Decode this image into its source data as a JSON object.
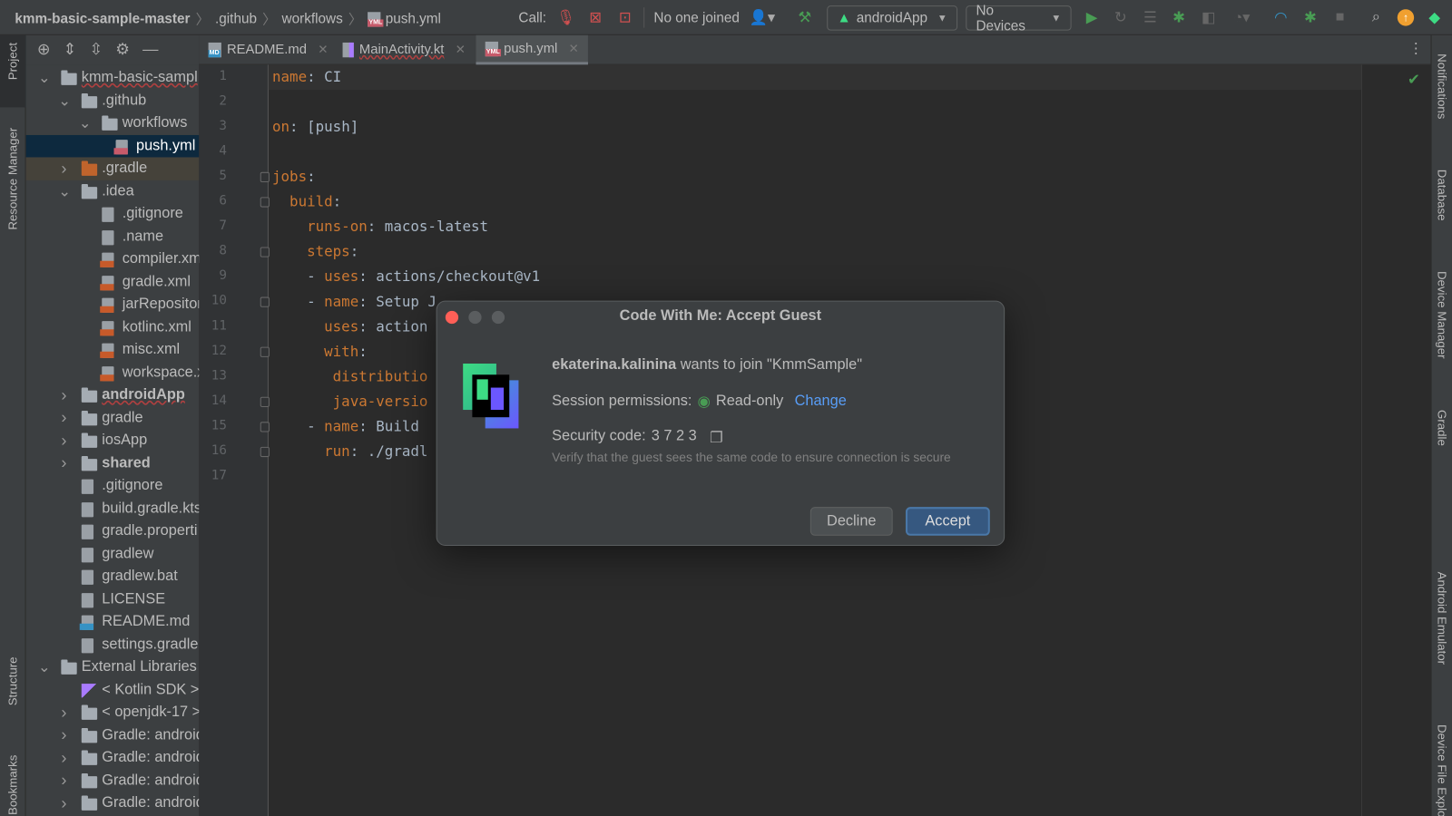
{
  "topbar": {
    "breadcrumb": [
      "kmm-basic-sample-master",
      ".github",
      "workflows",
      "push.yml"
    ],
    "call_label": "Call:",
    "participants": "No one joined",
    "run_config": "androidApp",
    "device": "No Devices"
  },
  "tabs": [
    {
      "label": "README.md",
      "badge": "MD"
    },
    {
      "label": "MainActivity.kt",
      "badge": ""
    },
    {
      "label": "push.yml",
      "badge": "YML",
      "active": true
    }
  ],
  "left_stripe": [
    "Project",
    "Resource Manager",
    "Structure",
    "Bookmarks"
  ],
  "right_stripe": [
    "Notifications",
    "Database",
    "Device Manager",
    "Gradle",
    "Android Emulator",
    "Device File Explorer"
  ],
  "tree": [
    {
      "label": "kmm-basic-sampl",
      "level": 0,
      "chev": "v",
      "icon": "module"
    },
    {
      "label": ".github",
      "level": 1,
      "chev": "v",
      "icon": "folder"
    },
    {
      "label": "workflows",
      "level": 2,
      "chev": "v",
      "icon": "folder"
    },
    {
      "label": "push.yml",
      "level": 3,
      "icon": "yml",
      "selected": true
    },
    {
      "label": ".gradle",
      "level": 1,
      "chev": ">",
      "icon": "folder-orange",
      "excluded": true
    },
    {
      "label": ".idea",
      "level": 1,
      "chev": "v",
      "icon": "folder"
    },
    {
      "label": ".gitignore",
      "level": 2,
      "icon": "ignore"
    },
    {
      "label": ".name",
      "level": 2,
      "icon": "text"
    },
    {
      "label": "compiler.xm",
      "level": 2,
      "icon": "xml"
    },
    {
      "label": "gradle.xml",
      "level": 2,
      "icon": "xml"
    },
    {
      "label": "jarRepositor",
      "level": 2,
      "icon": "xml"
    },
    {
      "label": "kotlinc.xml",
      "level": 2,
      "icon": "xml"
    },
    {
      "label": "misc.xml",
      "level": 2,
      "icon": "xml"
    },
    {
      "label": "workspace.x",
      "level": 2,
      "icon": "xml"
    },
    {
      "label": "androidApp",
      "level": 1,
      "chev": ">",
      "icon": "folder",
      "bold": true
    },
    {
      "label": "gradle",
      "level": 1,
      "chev": ">",
      "icon": "folder"
    },
    {
      "label": "iosApp",
      "level": 1,
      "chev": ">",
      "icon": "folder"
    },
    {
      "label": "shared",
      "level": 1,
      "chev": ">",
      "icon": "folder",
      "bold": true
    },
    {
      "label": ".gitignore",
      "level": 1,
      "icon": "ignore"
    },
    {
      "label": "build.gradle.kts",
      "level": 1,
      "icon": "gradle"
    },
    {
      "label": "gradle.properti",
      "level": 1,
      "icon": "text"
    },
    {
      "label": "gradlew",
      "level": 1,
      "icon": "exec"
    },
    {
      "label": "gradlew.bat",
      "level": 1,
      "icon": "text"
    },
    {
      "label": "LICENSE",
      "level": 1,
      "icon": "text"
    },
    {
      "label": "README.md",
      "level": 1,
      "icon": "md"
    },
    {
      "label": "settings.gradle.",
      "level": 1,
      "icon": "gradle"
    },
    {
      "label": "External Libraries",
      "level": 0,
      "chev": "v",
      "icon": "lib"
    },
    {
      "label": "< Kotlin SDK >",
      "level": 1,
      "icon": "kotlin"
    },
    {
      "label": "< openjdk-17 >",
      "level": 1,
      "chev": ">",
      "icon": "folder"
    },
    {
      "label": "Gradle: android",
      "level": 1,
      "chev": ">",
      "icon": "folder"
    },
    {
      "label": "Gradle: android",
      "level": 1,
      "chev": ">",
      "icon": "folder"
    },
    {
      "label": "Gradle: android",
      "level": 1,
      "chev": ">",
      "icon": "folder"
    },
    {
      "label": "Gradle: android",
      "level": 1,
      "chev": ">",
      "icon": "folder"
    }
  ],
  "code": [
    {
      "indent": "",
      "key": "name",
      "val": " CI"
    },
    {
      "indent": "",
      "key": "",
      "val": ""
    },
    {
      "indent": "",
      "key": "on",
      "val": " [push]"
    },
    {
      "indent": "",
      "key": "",
      "val": ""
    },
    {
      "indent": "",
      "key": "jobs",
      "val": ""
    },
    {
      "indent": "  ",
      "key": "build",
      "val": ""
    },
    {
      "indent": "    ",
      "key": "runs-on",
      "val": " macos-latest"
    },
    {
      "indent": "    ",
      "key": "steps",
      "val": ""
    },
    {
      "indent": "    - ",
      "key": "uses",
      "val": " actions/checkout@v1"
    },
    {
      "indent": "    - ",
      "key": "name",
      "val": " Setup J"
    },
    {
      "indent": "      ",
      "key": "uses",
      "val": " action"
    },
    {
      "indent": "      ",
      "key": "with",
      "val": ""
    },
    {
      "indent": "       ",
      "key": "distributio",
      "val": "",
      "nocolon": true
    },
    {
      "indent": "       ",
      "key": "java-versio",
      "val": "",
      "nocolon": true
    },
    {
      "indent": "    - ",
      "key": "name",
      "val": " Build"
    },
    {
      "indent": "      ",
      "key": "run",
      "val": " ./gradl"
    },
    {
      "indent": "",
      "key": "",
      "val": ""
    }
  ],
  "dialog": {
    "title": "Code With Me: Accept Guest",
    "guest": "ekaterina.kalinina",
    "join_text": " wants to join \"KmmSample\"",
    "permissions_label": "Session permissions:",
    "permission": "Read-only",
    "change": "Change",
    "security_label": "Security code:",
    "security_code": "3 7 2 3",
    "verify": "Verify that the guest sees the same code to ensure connection is secure",
    "decline": "Decline",
    "accept": "Accept"
  },
  "colors": {
    "accent": "#365880",
    "link": "#589df6",
    "green": "#499c54",
    "close": "#ff5f57"
  }
}
